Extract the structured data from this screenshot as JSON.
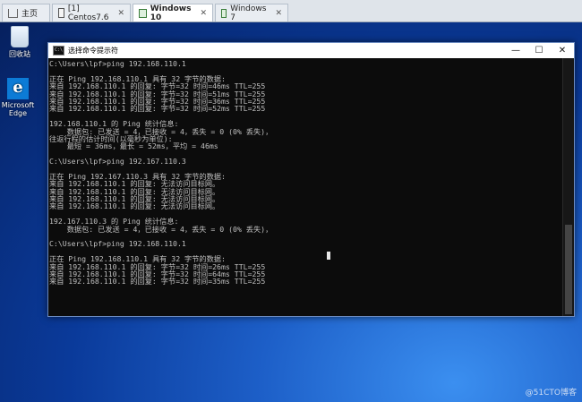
{
  "tabs": [
    {
      "label": "主页",
      "icon": "home-icon"
    },
    {
      "label": "[1] Centos7.6",
      "icon": "vm-icon"
    },
    {
      "label": "Windows 10",
      "icon": "windows-vm-icon",
      "active": true
    },
    {
      "label": "Windows 7",
      "icon": "windows-vm-icon"
    }
  ],
  "desktop": {
    "recycle_bin": "回收站",
    "edge": "Microsoft Edge",
    "watermark": "@51CTO博客"
  },
  "cmd": {
    "title": "选择命令提示符",
    "lines": [
      "C:\\Users\\lpf>ping 192.168.110.1",
      "",
      "正在 Ping 192.168.110.1 具有 32 字节的数据:",
      "来自 192.168.110.1 的回复: 字节=32 时间=46ms TTL=255",
      "来自 192.168.110.1 的回复: 字节=32 时间=51ms TTL=255",
      "来自 192.168.110.1 的回复: 字节=32 时间=36ms TTL=255",
      "来自 192.168.110.1 的回复: 字节=32 时间=52ms TTL=255",
      "",
      "192.168.110.1 的 Ping 统计信息:",
      "    数据包: 已发送 = 4，已接收 = 4，丢失 = 0 (0% 丢失)，",
      "往返行程的估计时间(以毫秒为单位):",
      "    最短 = 36ms，最长 = 52ms，平均 = 46ms",
      "",
      "C:\\Users\\lpf>ping 192.167.110.3",
      "",
      "正在 Ping 192.167.110.3 具有 32 字节的数据:",
      "来自 192.168.110.1 的回复: 无法访问目标网。",
      "来自 192.168.110.1 的回复: 无法访问目标网。",
      "来自 192.168.110.1 的回复: 无法访问目标网。",
      "来自 192.168.110.1 的回复: 无法访问目标网。",
      "",
      "192.167.110.3 的 Ping 统计信息:",
      "    数据包: 已发送 = 4，已接收 = 4，丢失 = 0 (0% 丢失)，",
      "",
      "C:\\Users\\lpf>ping 192.168.110.1",
      "",
      "正在 Ping 192.168.110.1 具有 32 字节的数据:",
      "来自 192.168.110.1 的回复: 字节=32 时间=26ms TTL=255",
      "来自 192.168.110.1 的回复: 字节=32 时间=64ms TTL=255",
      "来自 192.168.110.1 的回复: 字节=32 时间=35ms TTL=255"
    ]
  }
}
